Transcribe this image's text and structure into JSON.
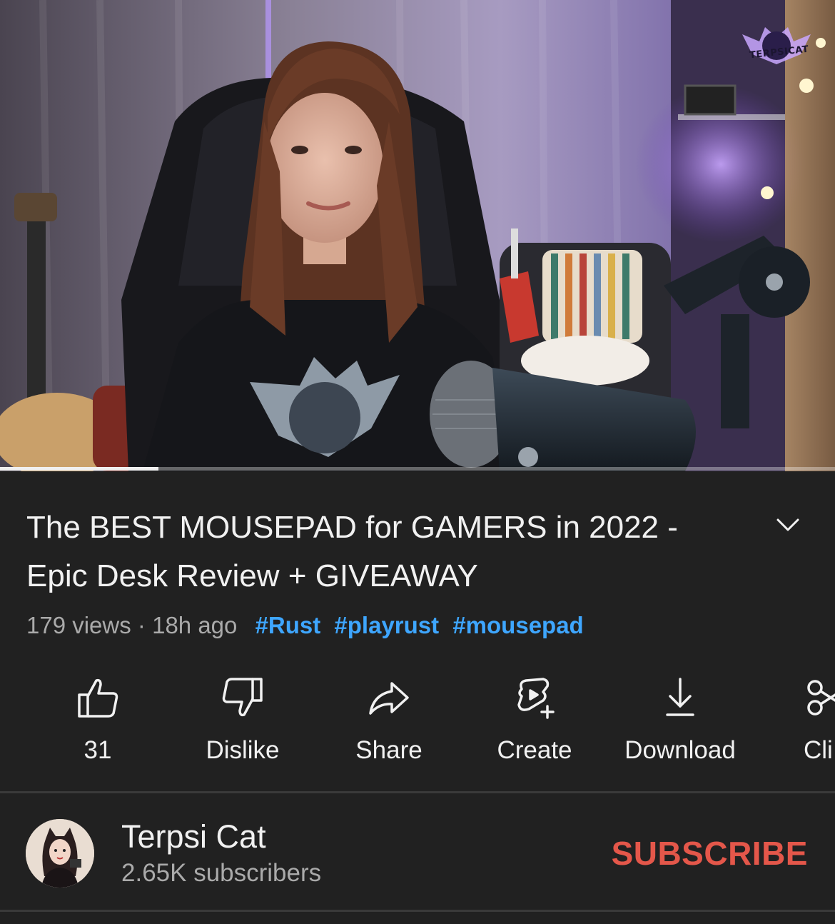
{
  "video": {
    "progress_fraction": 0.19,
    "watermark_text": "TERPSICAT"
  },
  "info": {
    "title": "The BEST MOUSEPAD for GAMERS in 2022 - Epic Desk Review + GIVEAWAY",
    "views": "179 views",
    "separator": "·",
    "age": "18h ago",
    "hashtags": [
      "#Rust",
      "#playrust",
      "#mousepad"
    ],
    "expand_icon": "chevron-down-icon"
  },
  "actions": [
    {
      "label": "31",
      "icon": "thumbs-up-icon"
    },
    {
      "label": "Dislike",
      "icon": "thumbs-down-icon"
    },
    {
      "label": "Share",
      "icon": "share-arrow-icon"
    },
    {
      "label": "Create",
      "icon": "create-plus-icon"
    },
    {
      "label": "Download",
      "icon": "download-icon"
    },
    {
      "label": "Cli",
      "icon": "scissors-icon"
    }
  ],
  "channel": {
    "name": "Terpsi Cat",
    "subscribers": "2.65K subscribers",
    "subscribe_label": "SUBSCRIBE",
    "subscribe_color": "#e4574a"
  },
  "colors": {
    "background": "#212121",
    "hashtag": "#3ea6ff",
    "muted_text": "#aaaaaa"
  }
}
